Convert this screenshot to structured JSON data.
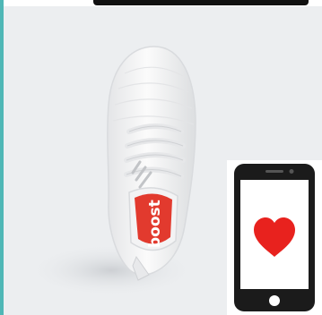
{
  "colors": {
    "accent": "#4fb7b6",
    "background": "#eceef0",
    "shoe": "#f7f7f7",
    "insole": "#e23a2e",
    "heart": "#e8221e",
    "phone_body": "#1b1b1b"
  },
  "product": {
    "insole_brand": "boost"
  },
  "icons": {
    "phone": "smartphone-icon",
    "heart": "heart-icon"
  }
}
